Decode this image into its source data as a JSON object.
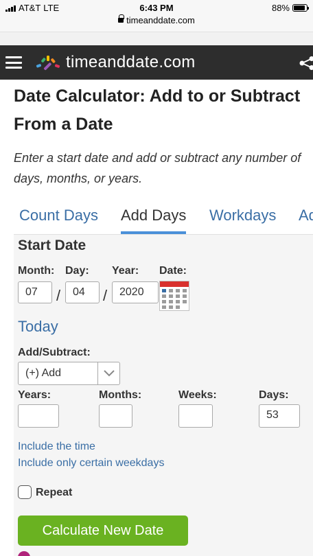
{
  "status_bar": {
    "carrier": "AT&T",
    "network": "LTE",
    "time": "6:43 PM",
    "url": "timeanddate.com",
    "battery": "88%",
    "battery_level": 0.88
  },
  "header": {
    "site_name": "timeanddate.com",
    "menu_icon": "hamburger-menu-icon",
    "share_icon": "share-icon",
    "background": "#2d2d2d"
  },
  "page": {
    "title_line1": "Date Calculator: Add to or Subtract",
    "title_line2": "From a Date",
    "intro_line1": "Enter a start date and add or subtract any number of",
    "intro_line2": "days, months, or years."
  },
  "tabs": [
    {
      "label": "Count Days",
      "active": false
    },
    {
      "label": "Add Days",
      "active": true
    },
    {
      "label": "Workdays",
      "active": false
    },
    {
      "label": "Add Workdays",
      "active": false
    }
  ],
  "form": {
    "start_date_title": "Start Date",
    "month_label": "Month:",
    "day_label": "Day:",
    "year_label": "Year:",
    "date_label": "Date:",
    "month_value": "07",
    "day_value": "04",
    "year_value": "2020",
    "separator": "/",
    "today_link": "Today",
    "add_subtract_label": "Add/Subtract:",
    "add_subtract_value": "(+) Add",
    "years_label": "Years:",
    "months_label": "Months:",
    "weeks_label": "Weeks:",
    "days_label": "Days:",
    "years_value": "",
    "months_value": "",
    "weeks_value": "",
    "days_value": "53",
    "include_time_link": "Include the time",
    "include_weekdays_link": "Include only certain weekdays",
    "repeat_label": "Repeat",
    "repeat_checked": false,
    "calculate_button": "Calculate New Date"
  },
  "colors": {
    "link": "#3a6ea5",
    "tab_underline": "#4a90d9",
    "button": "#6ab221",
    "panel": "#f5f5f5"
  }
}
